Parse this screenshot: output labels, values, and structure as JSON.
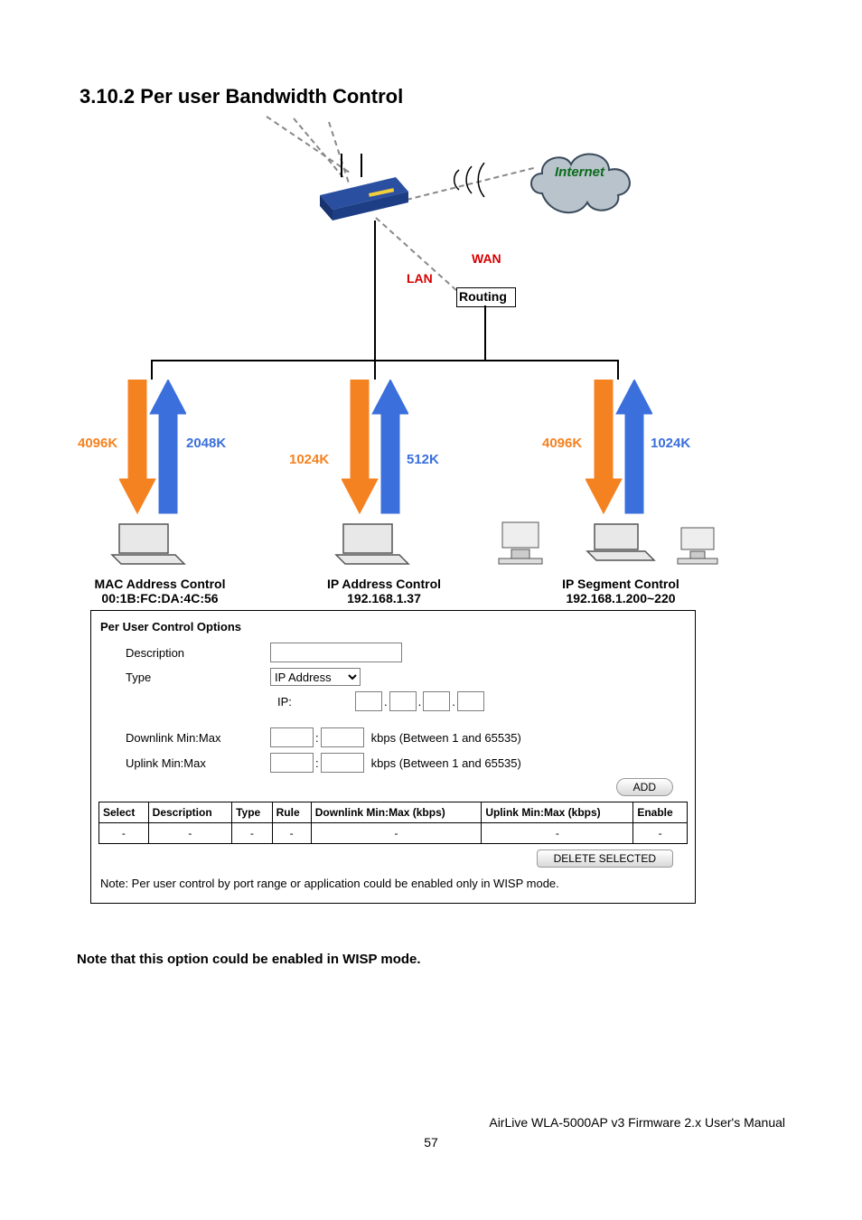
{
  "heading": "3.10.2 Per user Bandwidth Control",
  "diagram": {
    "internet": "Internet",
    "wan": "WAN",
    "lan": "LAN",
    "routing": "Routing",
    "nodes": [
      {
        "down": "4096K",
        "up": "2048K",
        "ctrl1": "MAC Address Control",
        "ctrl2": "00:1B:FC:DA:4C:56"
      },
      {
        "down": "1024K",
        "up": "512K",
        "ctrl1": "IP Address Control",
        "ctrl2": "192.168.1.37"
      },
      {
        "down": "4096K",
        "up": "1024K",
        "ctrl1": "IP Segment Control",
        "ctrl2": "192.168.1.200~220"
      }
    ]
  },
  "form": {
    "title": "Per User Control Options",
    "description_label": "Description",
    "description_value": "",
    "type_label": "Type",
    "type_value": "IP Address",
    "ip_label": "IP:",
    "ip": [
      "",
      "",
      "",
      ""
    ],
    "downlink_label": "Downlink Min:Max",
    "downlink_min": "",
    "downlink_max": "",
    "uplink_label": "Uplink Min:Max",
    "uplink_min": "",
    "uplink_max": "",
    "range_hint": "kbps (Between 1 and 65535)",
    "add_btn": "ADD",
    "headers": [
      "Select",
      "Description",
      "Type",
      "Rule",
      "Downlink Min:Max (kbps)",
      "Uplink Min:Max (kbps)",
      "Enable"
    ],
    "row": [
      "-",
      "-",
      "-",
      "-",
      "-",
      "-",
      "-"
    ],
    "delete_btn": "DELETE SELECTED",
    "panel_note": "Note: Per user control by port range or application could be enabled only in WISP mode."
  },
  "note_outside": "Note that this option could be enabled in WISP mode.",
  "footer": "AirLive WLA-5000AP v3 Firmware 2.x User's Manual",
  "page_number": "57"
}
